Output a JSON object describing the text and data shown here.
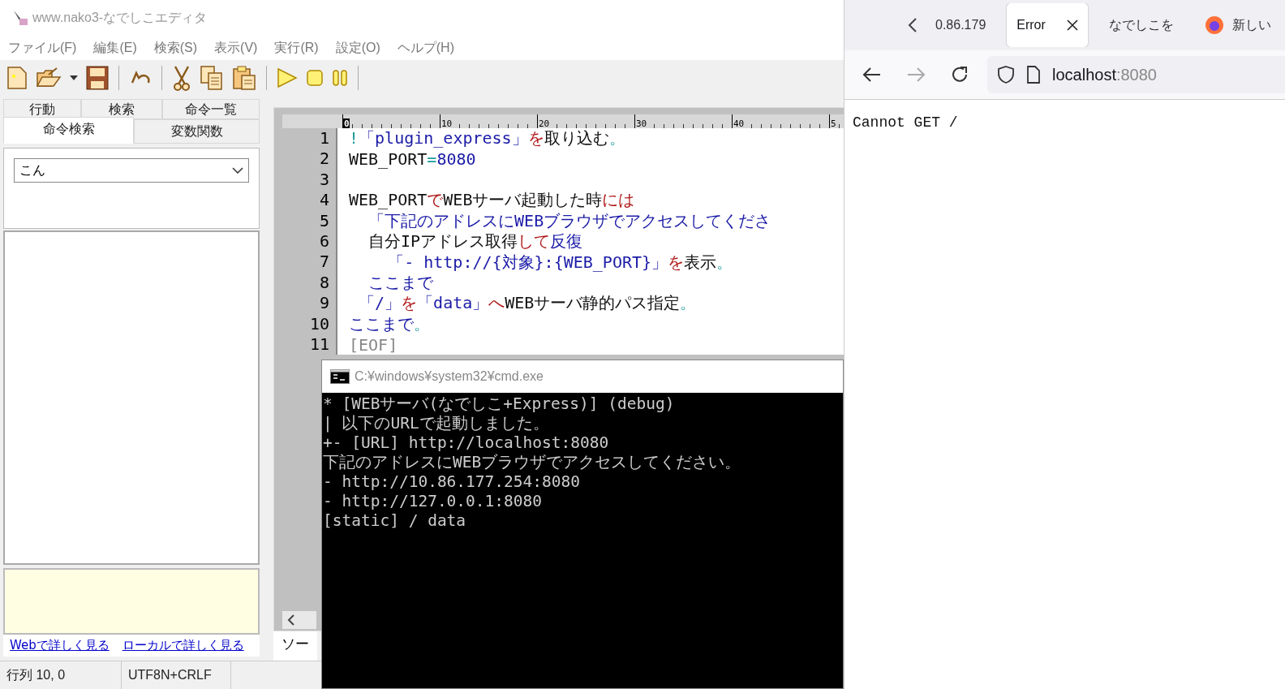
{
  "editor": {
    "title": "www.nako3-なでしこエディタ",
    "menu": [
      "ファイル(F)",
      "編集(E)",
      "検索(S)",
      "表示(V)",
      "実行(R)",
      "設定(O)",
      "ヘルプ(H)"
    ],
    "side_tabs": [
      {
        "label": "行動",
        "selected": false
      },
      {
        "label": "検索",
        "selected": false
      },
      {
        "label": "命令一覧",
        "selected": false
      },
      {
        "label": "命令検索",
        "selected": true
      },
      {
        "label": "変数関数",
        "selected": false
      }
    ],
    "search_combo": {
      "value": "こん"
    },
    "links": [
      "Webで詳しく見る",
      "ローカルで詳しく見る"
    ],
    "ruler": [
      "0",
      "10",
      "20",
      "30",
      "40",
      "5"
    ],
    "code_lines": [
      {
        "number": "1",
        "segments": [
          {
            "kind": "punct",
            "text": "!"
          },
          {
            "kind": "string",
            "text": "「plugin_express」"
          },
          {
            "kind": "keyword",
            "text": "を"
          },
          {
            "kind": "plain",
            "text": "取り込む"
          },
          {
            "kind": "punct",
            "text": "。"
          }
        ]
      },
      {
        "number": "2",
        "segments": [
          {
            "kind": "plain",
            "text": "WEB_PORT"
          },
          {
            "kind": "punct",
            "text": "="
          },
          {
            "kind": "string",
            "text": "8080"
          }
        ]
      },
      {
        "number": "3"
      },
      {
        "number": "4",
        "segments": [
          {
            "kind": "plain",
            "text": "WEB_PORT"
          },
          {
            "kind": "keyword",
            "text": "で"
          },
          {
            "kind": "plain",
            "text": "WEBサーバ起動した時"
          },
          {
            "kind": "keyword",
            "text": "には"
          }
        ]
      },
      {
        "number": "5",
        "segments": [
          {
            "kind": "string",
            "text": "  「下記のアドレスにWEBブラウザでアクセスしてくださ"
          }
        ]
      },
      {
        "number": "6",
        "segments": [
          {
            "kind": "plain",
            "text": "  自分IPアドレス取得"
          },
          {
            "kind": "keyword",
            "text": "して"
          },
          {
            "kind": "string",
            "text": "反復"
          }
        ]
      },
      {
        "number": "7",
        "segments": [
          {
            "kind": "string",
            "text": "    「- http://{対象}:{WEB_PORT}」"
          },
          {
            "kind": "keyword",
            "text": "を"
          },
          {
            "kind": "plain",
            "text": "表示"
          },
          {
            "kind": "punct",
            "text": "。"
          }
        ]
      },
      {
        "number": "8",
        "segments": [
          {
            "kind": "string",
            "text": "  ここまで"
          }
        ]
      },
      {
        "number": "9",
        "segments": [
          {
            "kind": "string",
            "text": " 「/」"
          },
          {
            "kind": "keyword",
            "text": "を"
          },
          {
            "kind": "string",
            "text": "「data」"
          },
          {
            "kind": "keyword",
            "text": "へ"
          },
          {
            "kind": "plain",
            "text": "WEBサーバ静的パス指定"
          },
          {
            "kind": "punct",
            "text": "。"
          }
        ]
      },
      {
        "number": "10",
        "segments": [
          {
            "kind": "string",
            "text": "ここまで"
          },
          {
            "kind": "punct",
            "text": "。"
          }
        ]
      },
      {
        "number": "11",
        "segments": [
          {
            "kind": "eof",
            "text": "[EOF]"
          }
        ]
      }
    ],
    "bottom_tab": "ソー",
    "status": [
      "行列 10, 0",
      "UTF8N+CRLF"
    ]
  },
  "console": {
    "title": "C:¥windows¥system32¥cmd.exe",
    "lines": [
      "* [WEBサーバ(なでしこ+Express)] (debug)",
      "| 以下のURLで起動しました。",
      "+- [URL] http://localhost:8080",
      "下記のアドレスにWEBブラウザでアクセスしてください。",
      "- http://10.86.177.254:8080",
      "- http://127.0.0.1:8080",
      "[static] / data"
    ]
  },
  "browser": {
    "tabs": [
      {
        "label": "0.86.179",
        "selected": false,
        "kind": "page"
      },
      {
        "label": "Error",
        "selected": true,
        "kind": "page"
      },
      {
        "label": "なでしこを",
        "selected": false,
        "kind": "page"
      },
      {
        "label": "新しい",
        "selected": false,
        "kind": "new"
      }
    ],
    "url": {
      "host": "localhost",
      "port": ":8080"
    },
    "body": "Cannot GET /"
  }
}
